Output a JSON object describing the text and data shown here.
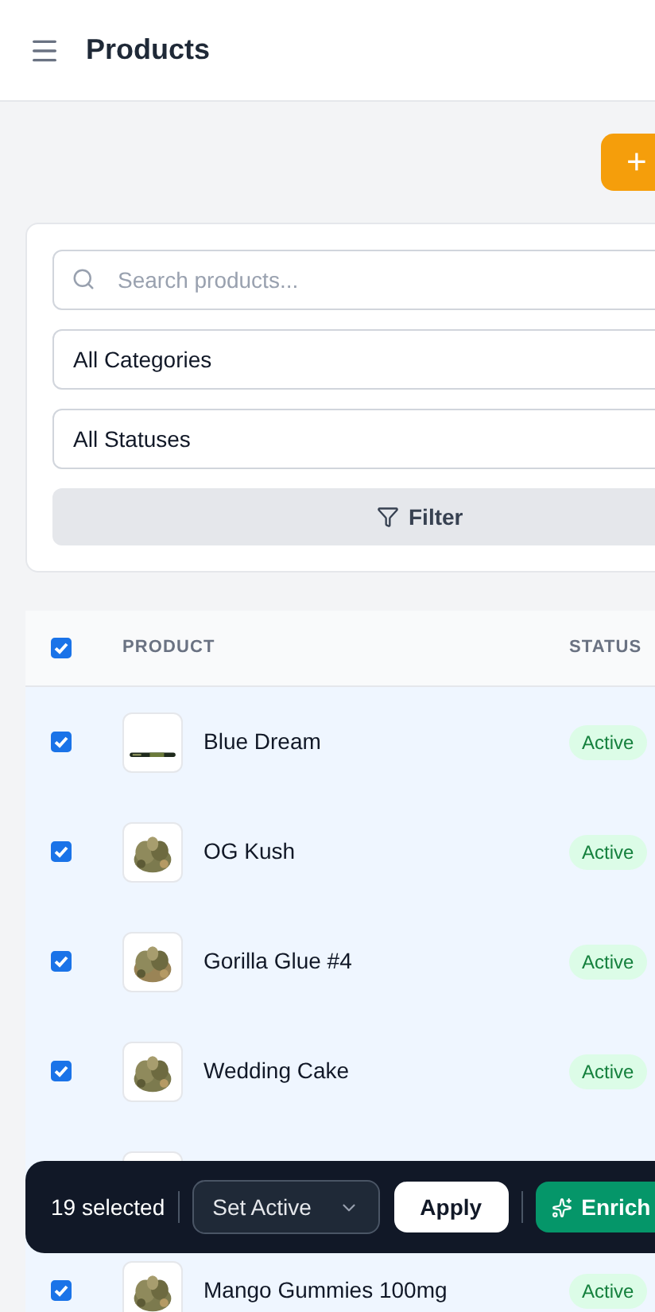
{
  "header": {
    "title": "Products"
  },
  "add_button": {
    "label": "+"
  },
  "filters": {
    "search": {
      "placeholder": "Search products..."
    },
    "category": {
      "value": "All Categories"
    },
    "status": {
      "value": "All Statuses"
    },
    "filter_button": {
      "label": "Filter"
    }
  },
  "table": {
    "select_all": {
      "checked": true
    },
    "columns": [
      "PRODUCT",
      "STATUS"
    ],
    "rows": [
      {
        "kind": "product",
        "name": "Blue Dream",
        "status": "Active",
        "checked": true,
        "selected": true
      },
      {
        "kind": "product",
        "name": "OG Kush",
        "status": "Active",
        "checked": true,
        "selected": true
      },
      {
        "kind": "product",
        "name": "Gorilla Glue #4",
        "status": "Active",
        "checked": true,
        "selected": true
      },
      {
        "kind": "product",
        "name": "Wedding Cake",
        "status": "Active",
        "checked": true,
        "selected": true
      },
      {
        "kind": "covered",
        "selected": true
      },
      {
        "kind": "product",
        "name": "Mango Gummies 100mg",
        "status": "Active",
        "checked": true,
        "selected": true
      }
    ]
  },
  "bulk_bar": {
    "count": "19 selected",
    "action": {
      "value": "Set Active"
    },
    "apply": "Apply",
    "enrich": "Enrich"
  }
}
